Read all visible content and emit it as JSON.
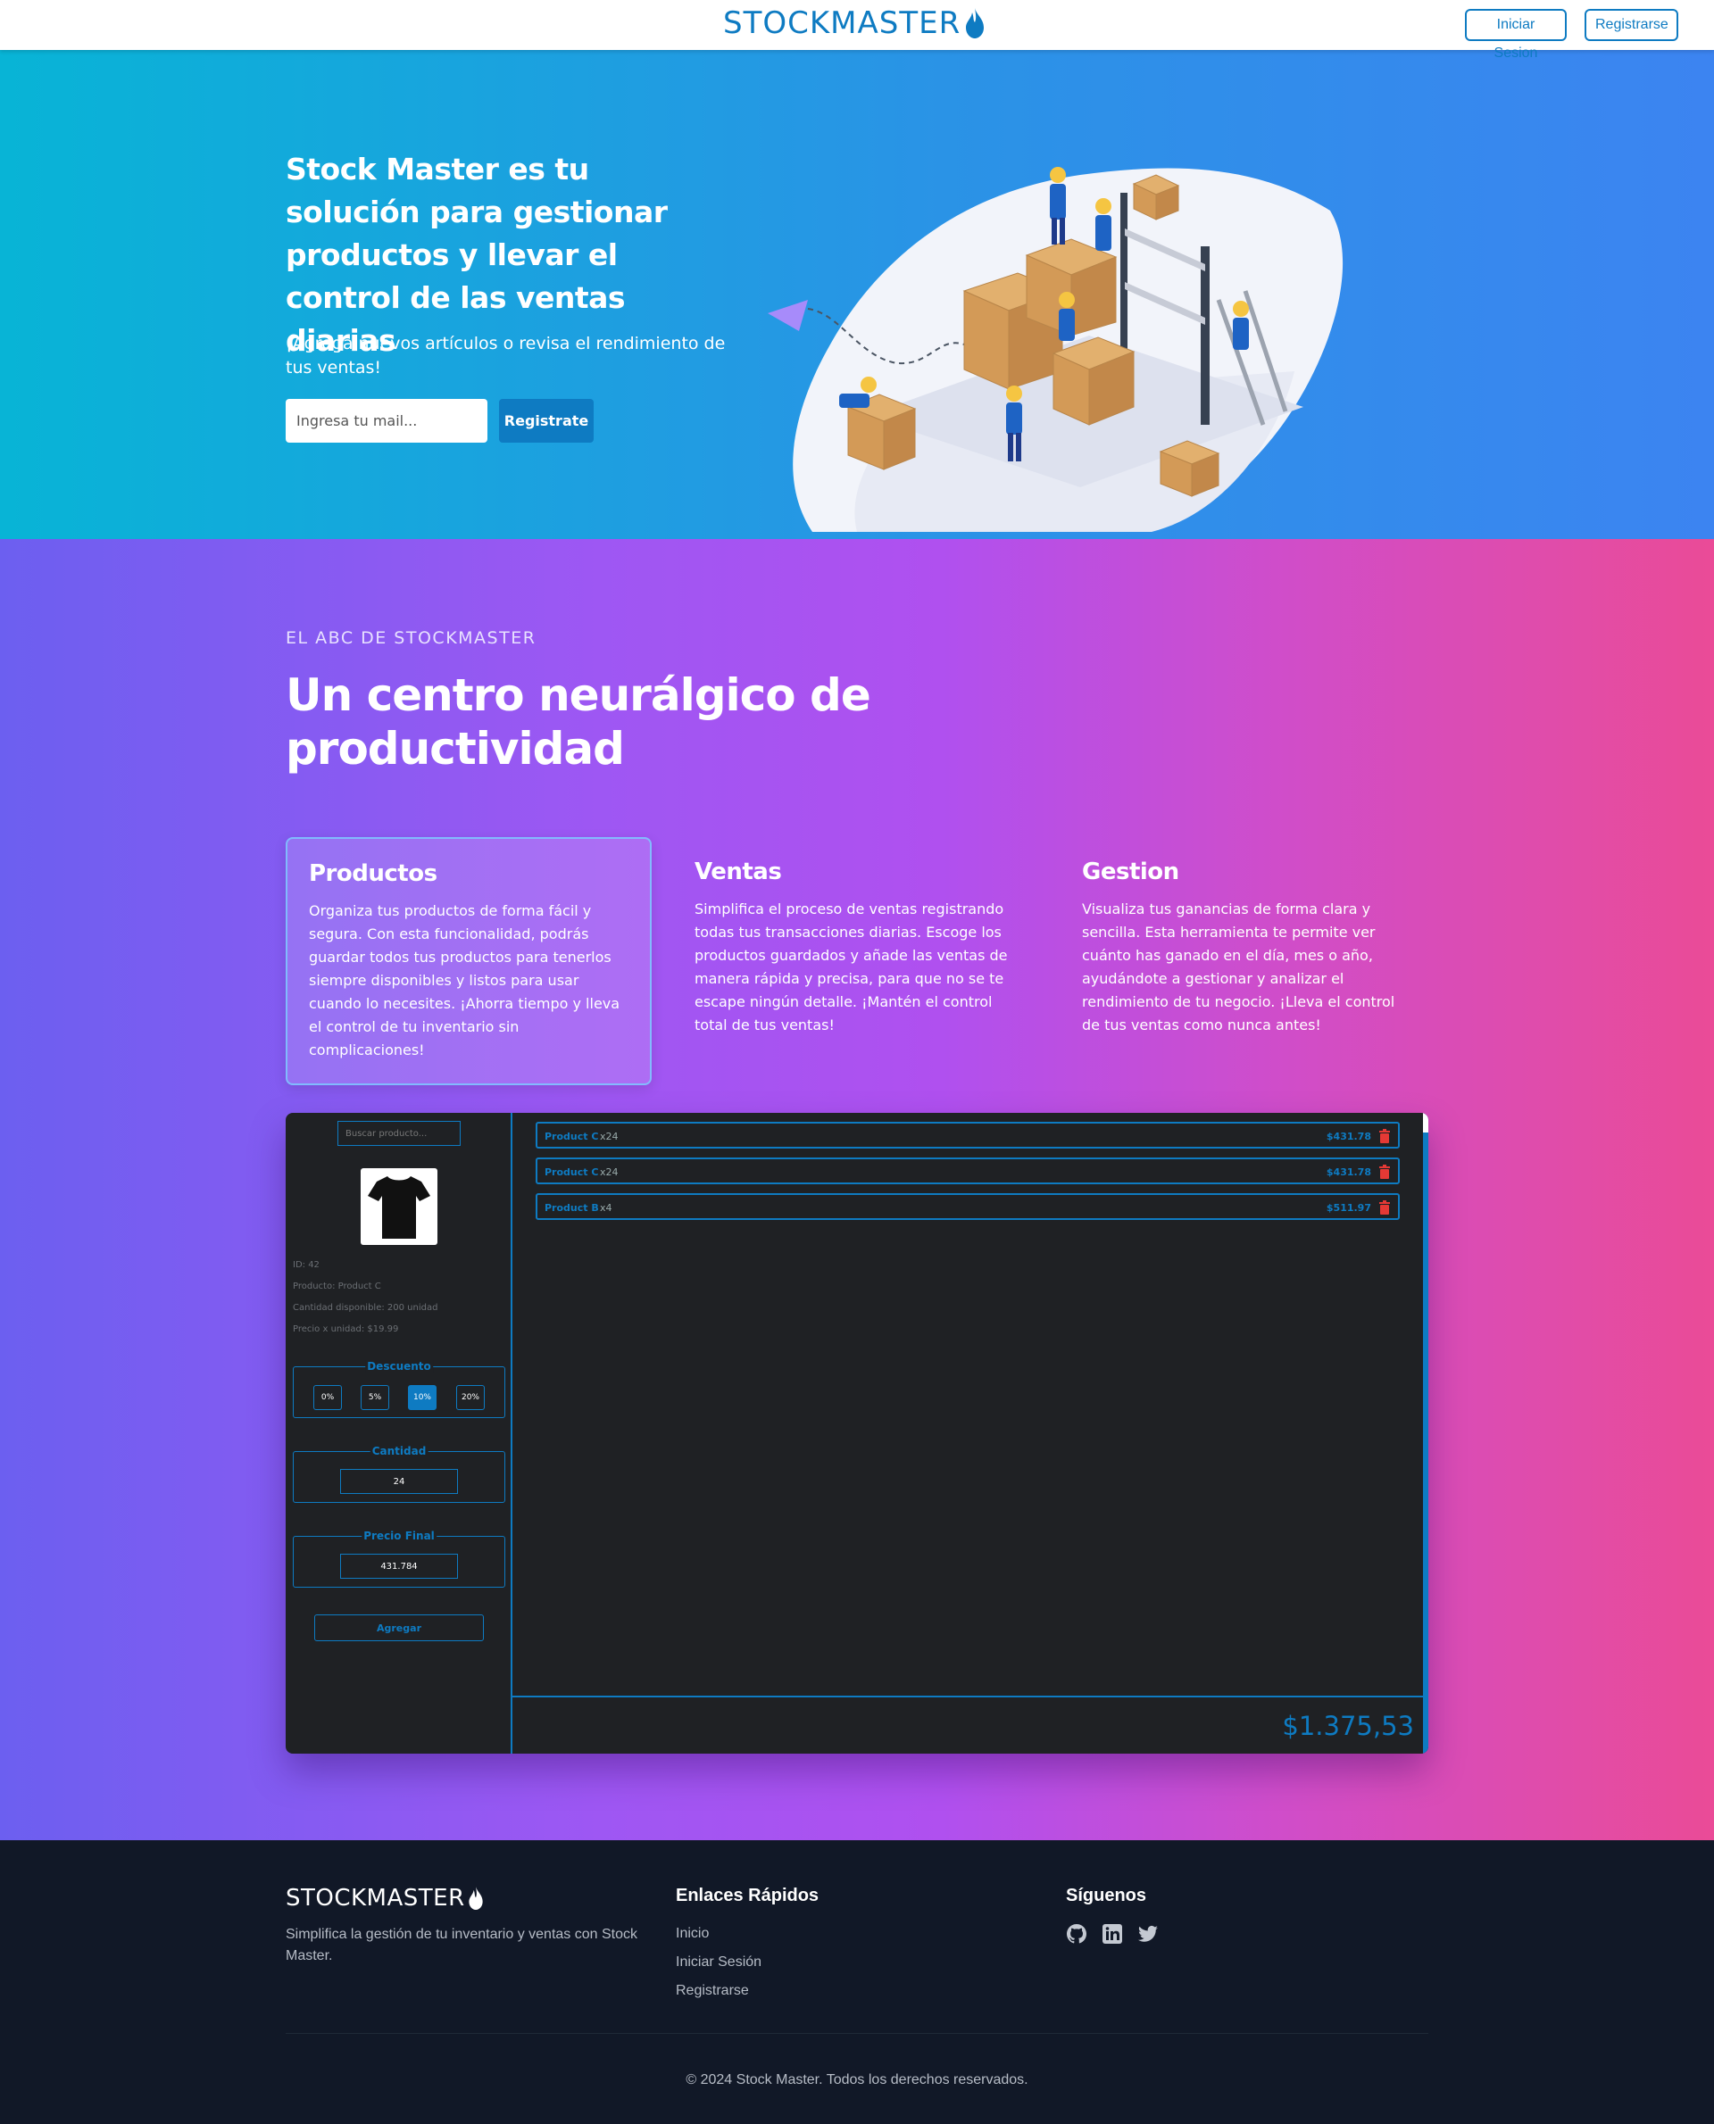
{
  "navbar": {
    "logo_text": "STOCKMASTER",
    "login_label": "Iniciar Sesion",
    "register_label": "Registrarse",
    "accent_color": "#0e7bc2"
  },
  "hero": {
    "title": "Stock Master es tu solución para gestionar productos y llevar el control de las ventas diarias",
    "subtitle": "¡Agrega nuevos artículos o revisa el rendimiento de tus ventas!",
    "email_placeholder": "Ingresa tu mail...",
    "cta_label": "Registrate"
  },
  "features": {
    "eyebrow": "EL ABC DE STOCKMASTER",
    "title": "Un centro neurálgico de productividad",
    "cards": [
      {
        "title": "Productos",
        "text": "Organiza tus productos de forma fácil y segura. Con esta funcionalidad, podrás guardar todos tus productos para tenerlos siempre disponibles y listos para usar cuando lo necesites. ¡Ahorra tiempo y lleva el control de tu inventario sin complicaciones!"
      },
      {
        "title": "Ventas",
        "text": "Simplifica el proceso de ventas registrando todas tus transacciones diarias. Escoge los productos guardados y añade las ventas de manera rápida y precisa, para que no se te escape ningún detalle. ¡Mantén el control total de tus ventas!"
      },
      {
        "title": "Gestion",
        "text": "Visualiza tus ganancias de forma clara y sencilla. Esta herramienta te permite ver cuánto has ganado en el día, mes o año, ayudándote a gestionar y analizar el rendimiento de tu negocio. ¡Lleva el control de tus ventas como nunca antes!"
      }
    ]
  },
  "app_demo": {
    "search_placeholder": "Buscar producto...",
    "product_info": {
      "id": "ID: 42",
      "name": "Producto: Product C",
      "stock": "Cantidad disponible: 200 unidad",
      "unit_price": "Precio x unidad: $19.99"
    },
    "discount_legend": "Descuento",
    "discounts": [
      "0%",
      "5%",
      "10%",
      "20%"
    ],
    "selected_discount": "10%",
    "quantity_legend": "Cantidad",
    "quantity_value": "24",
    "final_price_legend": "Precio Final",
    "final_price_value": "431.784",
    "add_label": "Agregar",
    "cart": [
      {
        "name": "Product C",
        "qty": "x24",
        "price": "$431.78"
      },
      {
        "name": "Product C",
        "qty": "x24",
        "price": "$431.78"
      },
      {
        "name": "Product B",
        "qty": "x4",
        "price": "$511.97"
      }
    ],
    "total": "$1.375,53",
    "delete_icon_color": "#e53935"
  },
  "footer": {
    "logo_text": "STOCKMASTER",
    "description": "Simplifica la gestión de tu inventario y ventas con Stock Master.",
    "links_heading": "Enlaces Rápidos",
    "links": [
      "Inicio",
      "Iniciar Sesión",
      "Registrarse"
    ],
    "social_heading": "Síguenos",
    "social_icons": [
      "github-icon",
      "linkedin-icon",
      "twitter-icon"
    ],
    "copyright": "© 2024 Stock Master. Todos los derechos reservados."
  }
}
